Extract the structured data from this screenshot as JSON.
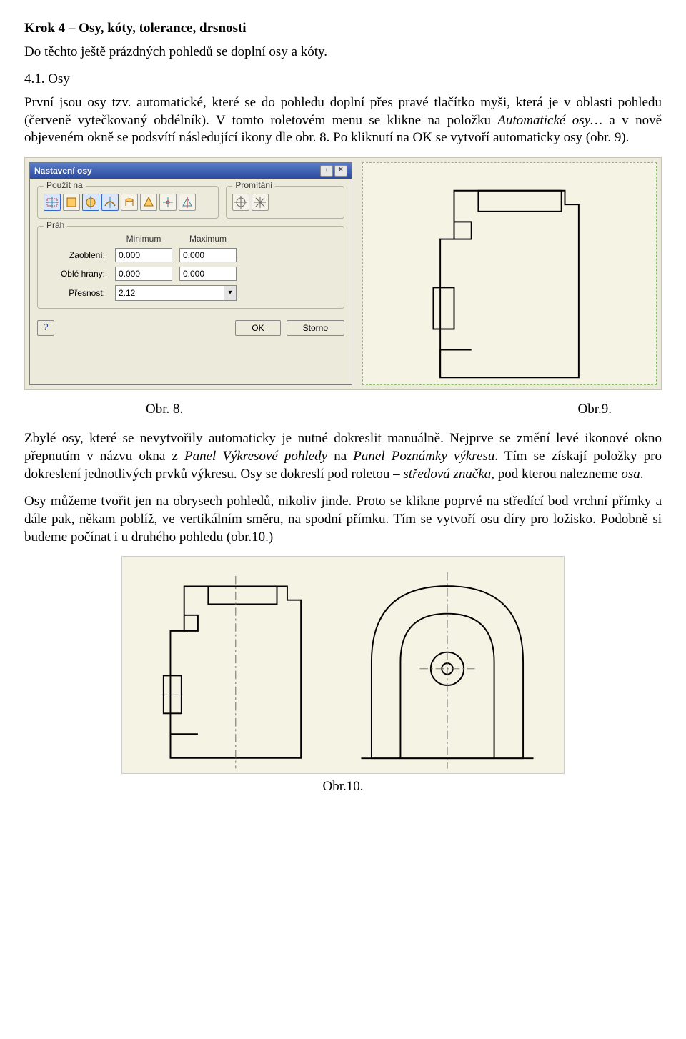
{
  "heading": "Krok 4 – Osy, kóty, tolerance, drsnosti",
  "intro": "Do těchto ještě  prázdných  pohledů se doplní  osy a kóty.",
  "subheading": "4.1. Osy",
  "para1_plain1": "První jsou osy tzv.  automatické, které  se do pohledu doplní přes pravé tlačítko myši, která je v oblasti pohledu (červeně vytečkovaný obdélník). V tomto roletovém menu se klikne na položku ",
  "para1_italic": "Automatické osy…",
  "para1_plain2": " a v nově objeveném okně se podsvítí následující ikony  dle obr. 8. Po kliknutí na OK se vytvoří automaticky osy (obr. 9).",
  "dialog": {
    "title": "Nastavení osy",
    "group_use": "Použít na",
    "group_proj": "Promítání",
    "group_threshold": "Práh",
    "hdr_min": "Minimum",
    "hdr_max": "Maximum",
    "lbl_zaobleni": "Zaoblení:",
    "lbl_oblehrany": "Oblé hrany:",
    "lbl_presnost": "Přesnost:",
    "val_zaobleni_min": "0.000",
    "val_zaobleni_max": "0.000",
    "val_oble_min": "0.000",
    "val_oble_max": "0.000",
    "val_presnost": "2.12",
    "btn_ok": "OK",
    "btn_storno": "Storno",
    "btn_help": "?"
  },
  "caption8": "Obr. 8.",
  "caption9": "Obr.9.",
  "para2_a": "Zbylé osy, které se nevytvořily automaticky je nutné dokreslit manuálně. Nejprve se změní levé ikonové okno přepnutím v názvu okna z ",
  "para2_i1": "Panel Výkresové pohledy",
  "para2_b": " na ",
  "para2_i2": "Panel Poznámky výkresu",
  "para2_c": ". Tím se získají položky pro dokreslení jednotlivých  prvků výkresu. Osy se dokreslí pod roletou – ",
  "para2_i3": "středová značka",
  "para2_d": ", pod kterou nalezneme ",
  "para2_i4": "osa",
  "para2_e": ".",
  "para3": "Osy můžeme tvořit jen na obrysech pohledů, nikoliv jinde. Proto se klikne poprvé na středící bod vrchní přímky a dále pak, někam poblíž,  ve vertikálním směru, na spodní přímku. Tím se vytvoří osu díry pro ložisko. Podobně si budeme počínat i u druhého pohledu (obr.10.)",
  "caption10": "Obr.10."
}
